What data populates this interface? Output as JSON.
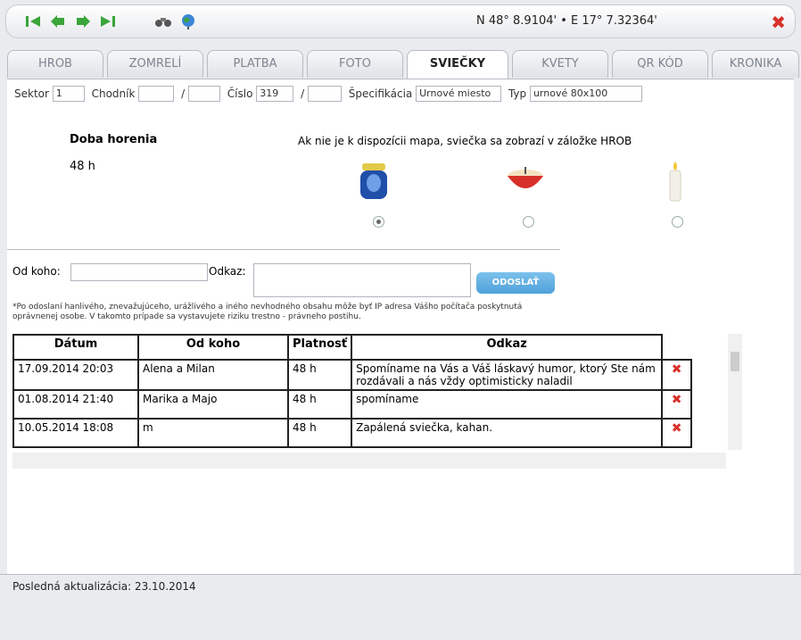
{
  "toolbar": {
    "coords": "N 48° 8.9104' • E 17° 7.32364'",
    "icons": [
      "first-icon",
      "prev-icon",
      "next-icon",
      "last-icon",
      "binoculars-icon",
      "globe-icon",
      "close-icon"
    ]
  },
  "tabs": [
    {
      "label": "HROB"
    },
    {
      "label": "ZOMRELÍ"
    },
    {
      "label": "PLATBA"
    },
    {
      "label": "FOTO"
    },
    {
      "label": "SVIEČKY",
      "active": true
    },
    {
      "label": "KVETY"
    },
    {
      "label": "QR KÓD"
    },
    {
      "label": "KRONIKA"
    }
  ],
  "filter": {
    "sektor_label": "Sektor",
    "sektor_value": "1",
    "chodnik_label": "Chodník",
    "chodnik_value": "",
    "slash": "/",
    "cislo_label": "Číslo",
    "cislo_value": "319",
    "cislo2_value": "",
    "spec_label": "Špecifikácia",
    "spec_value": "Urnové miesto",
    "typ_label": "Typ",
    "typ_value": "urnové 80x100"
  },
  "candles": {
    "title": "Doba horenia",
    "value": "48 h",
    "note": "Ak nie je k dispozícii mapa, sviečka sa zobrazí v záložke HROB",
    "selected": 0
  },
  "form": {
    "od_koho_label": "Od koho:",
    "odkaz_label": "Odkaz:",
    "send_label": "ODOSLAŤ",
    "disclaimer": "*Po odoslaní hanlivého, znevažujúceho, urážlivého a iného nevhodného obsahu môže byť IP adresa Vášho počítača poskytnutá oprávnenej osobe. V takomto prípade sa vystavujete riziku trestno - právneho postihu."
  },
  "table": {
    "headers": [
      "Dátum",
      "Od koho",
      "Platnosť",
      "Odkaz"
    ],
    "rows": [
      {
        "datum": "17.09.2014 20:03",
        "od": "Alena a Milan",
        "platnost": "48 h",
        "odkaz": "Spomíname na Vás a Váš láskavý humor, ktorý Ste nám rozdávali a nás vždy optimisticky naladil"
      },
      {
        "datum": "01.08.2014 21:40",
        "od": "Marika a Majo",
        "platnost": "48 h",
        "odkaz": "spomíname"
      },
      {
        "datum": "10.05.2014 18:08",
        "od": "m",
        "platnost": "48 h",
        "odkaz": "Zapálená sviečka, kahan."
      }
    ]
  },
  "footer": {
    "text": "Posledná aktualizácia: 23.10.2014"
  }
}
